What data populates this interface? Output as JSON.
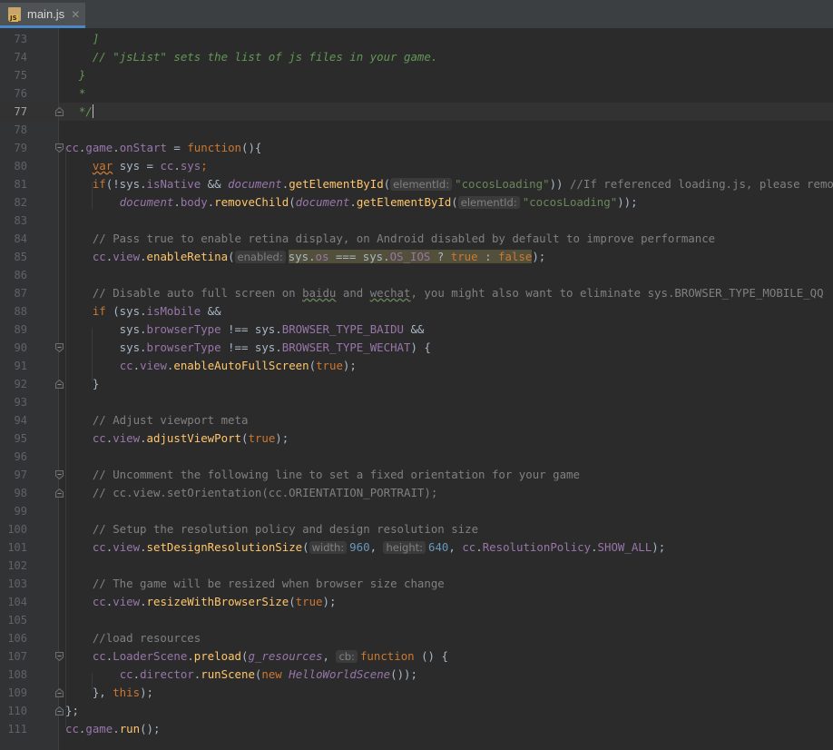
{
  "tab": {
    "file_name": "main.js",
    "icon": "js-file-icon",
    "close_icon": "close-icon",
    "badge": "JS"
  },
  "gutter": {
    "current_line": 77
  },
  "colors": {
    "background": "#2b2b2b",
    "gutter": "#313335",
    "keyword": "#cc7832",
    "string": "#6a8759",
    "number": "#6897bb",
    "comment": "#808080",
    "doc_comment": "#629755",
    "function": "#ffc66d",
    "property": "#9876aa"
  },
  "lines": [
    {
      "n": 73,
      "indent": 4,
      "tokens": [
        [
          "    ]",
          "dc"
        ]
      ]
    },
    {
      "n": 74,
      "indent": 4,
      "tokens": [
        [
          "    // \"jsList\" sets the list of js files in your game.",
          "dc"
        ]
      ]
    },
    {
      "n": 75,
      "tokens": [
        [
          "  }",
          "dc"
        ]
      ]
    },
    {
      "n": 76,
      "tokens": [
        [
          "  *",
          "dc"
        ]
      ]
    },
    {
      "n": 77,
      "fold": "end",
      "tokens": [
        [
          "  */",
          "dc"
        ],
        [
          "",
          "cursor"
        ]
      ]
    },
    {
      "n": 78,
      "tokens": []
    },
    {
      "n": 79,
      "fold": "start",
      "tokens": [
        [
          "cc",
          "pr"
        ],
        [
          ".",
          ""
        ],
        [
          "game",
          "pr"
        ],
        [
          ".",
          ""
        ],
        [
          "onStart",
          "pr"
        ],
        [
          " = ",
          ""
        ],
        [
          "function",
          "kw"
        ],
        [
          "(){",
          ""
        ]
      ]
    },
    {
      "n": 80,
      "tokens": [
        [
          "    ",
          ""
        ],
        [
          "var",
          "kw wavyk"
        ],
        [
          " sys = ",
          ""
        ],
        [
          "cc",
          "pr"
        ],
        [
          ".",
          ""
        ],
        [
          "sys",
          "pr"
        ],
        [
          ";",
          "kw"
        ]
      ]
    },
    {
      "n": 81,
      "tokens": [
        [
          "    ",
          ""
        ],
        [
          "if",
          "kw"
        ],
        [
          "(!sys.",
          ""
        ],
        [
          "isNative",
          "pr"
        ],
        [
          " && ",
          ""
        ],
        [
          "document",
          "ft"
        ],
        [
          ".",
          ""
        ],
        [
          "getElementById",
          "fn"
        ],
        [
          "(",
          ""
        ],
        [
          "elementId:",
          "hint"
        ],
        [
          "\"cocosLoading\"",
          "st"
        ],
        [
          ")) ",
          ""
        ],
        [
          "//If referenced loading.js, please remove it",
          "cm"
        ]
      ]
    },
    {
      "n": 82,
      "tokens": [
        [
          "        ",
          ""
        ],
        [
          "document",
          "ft"
        ],
        [
          ".",
          ""
        ],
        [
          "body",
          "pr"
        ],
        [
          ".",
          ""
        ],
        [
          "removeChild",
          "fn"
        ],
        [
          "(",
          ""
        ],
        [
          "document",
          "ft"
        ],
        [
          ".",
          ""
        ],
        [
          "getElementById",
          "fn"
        ],
        [
          "(",
          ""
        ],
        [
          "elementId:",
          "hint"
        ],
        [
          "\"cocosLoading\"",
          "st"
        ],
        [
          "));",
          ""
        ]
      ]
    },
    {
      "n": 83,
      "tokens": []
    },
    {
      "n": 84,
      "tokens": [
        [
          "    // Pass true to enable retina display, on Android disabled by default to improve performance",
          "cm"
        ]
      ]
    },
    {
      "n": 85,
      "tokens": [
        [
          "    ",
          ""
        ],
        [
          "cc",
          "pr"
        ],
        [
          ".",
          ""
        ],
        [
          "view",
          "pr"
        ],
        [
          ".",
          ""
        ],
        [
          "enableRetina",
          "fn"
        ],
        [
          "(",
          ""
        ],
        [
          "enabled:",
          "hint"
        ],
        [
          "sys.",
          "hl"
        ],
        [
          "os",
          "hl pr"
        ],
        [
          " === sys.",
          "hl"
        ],
        [
          "OS_IOS",
          "hl pr"
        ],
        [
          " ? ",
          "hl"
        ],
        [
          "true",
          "hl kw"
        ],
        [
          " : ",
          "hl"
        ],
        [
          "false",
          "hl kw"
        ],
        [
          ");",
          ""
        ]
      ]
    },
    {
      "n": 86,
      "tokens": []
    },
    {
      "n": 87,
      "tokens": [
        [
          "    // Disable auto full screen on ",
          "cm"
        ],
        [
          "baidu",
          "cm wavy"
        ],
        [
          " and ",
          "cm"
        ],
        [
          "wechat",
          "cm wavy"
        ],
        [
          ", you might also want to eliminate sys.BROWSER_TYPE_MOBILE_QQ",
          "cm"
        ]
      ]
    },
    {
      "n": 88,
      "tokens": [
        [
          "    ",
          ""
        ],
        [
          "if",
          "kw"
        ],
        [
          " (sys.",
          ""
        ],
        [
          "isMobile",
          "pr"
        ],
        [
          " &&",
          ""
        ]
      ]
    },
    {
      "n": 89,
      "tokens": [
        [
          "        sys.",
          ""
        ],
        [
          "browserType",
          "pr"
        ],
        [
          " !== sys.",
          ""
        ],
        [
          "BROWSER_TYPE_BAIDU",
          "pr"
        ],
        [
          " &&",
          ""
        ]
      ]
    },
    {
      "n": 90,
      "fold": "start",
      "tokens": [
        [
          "        sys.",
          ""
        ],
        [
          "browserType",
          "pr"
        ],
        [
          " !== sys.",
          ""
        ],
        [
          "BROWSER_TYPE_WECHAT",
          "pr"
        ],
        [
          ") {",
          ""
        ]
      ]
    },
    {
      "n": 91,
      "tokens": [
        [
          "        ",
          ""
        ],
        [
          "cc",
          "pr"
        ],
        [
          ".",
          ""
        ],
        [
          "view",
          "pr"
        ],
        [
          ".",
          ""
        ],
        [
          "enableAutoFullScreen",
          "fn"
        ],
        [
          "(",
          ""
        ],
        [
          "true",
          "kw"
        ],
        [
          ");",
          ""
        ]
      ]
    },
    {
      "n": 92,
      "fold": "end",
      "tokens": [
        [
          "    }",
          ""
        ]
      ]
    },
    {
      "n": 93,
      "tokens": []
    },
    {
      "n": 94,
      "tokens": [
        [
          "    // Adjust viewport meta",
          "cm"
        ]
      ]
    },
    {
      "n": 95,
      "tokens": [
        [
          "    ",
          ""
        ],
        [
          "cc",
          "pr"
        ],
        [
          ".",
          ""
        ],
        [
          "view",
          "pr"
        ],
        [
          ".",
          ""
        ],
        [
          "adjustViewPort",
          "fn"
        ],
        [
          "(",
          ""
        ],
        [
          "true",
          "kw"
        ],
        [
          ");",
          ""
        ]
      ]
    },
    {
      "n": 96,
      "tokens": []
    },
    {
      "n": 97,
      "fold": "start",
      "tokens": [
        [
          "    // Uncomment the following line to set a fixed orientation for your game",
          "cm"
        ]
      ]
    },
    {
      "n": 98,
      "fold": "end",
      "tokens": [
        [
          "    // cc.view.setOrientation(cc.ORIENTATION_PORTRAIT);",
          "cm"
        ]
      ]
    },
    {
      "n": 99,
      "tokens": []
    },
    {
      "n": 100,
      "tokens": [
        [
          "    // Setup the resolution policy and design resolution size",
          "cm"
        ]
      ]
    },
    {
      "n": 101,
      "tokens": [
        [
          "    ",
          ""
        ],
        [
          "cc",
          "pr"
        ],
        [
          ".",
          ""
        ],
        [
          "view",
          "pr"
        ],
        [
          ".",
          ""
        ],
        [
          "setDesignResolutionSize",
          "fn"
        ],
        [
          "(",
          ""
        ],
        [
          "width:",
          "hint"
        ],
        [
          "960",
          "nu"
        ],
        [
          ", ",
          ""
        ],
        [
          "height:",
          "hint"
        ],
        [
          "640",
          "nu"
        ],
        [
          ", ",
          ""
        ],
        [
          "cc",
          "pr"
        ],
        [
          ".",
          ""
        ],
        [
          "ResolutionPolicy",
          "pr"
        ],
        [
          ".",
          ""
        ],
        [
          "SHOW_ALL",
          "pr"
        ],
        [
          ");",
          ""
        ]
      ]
    },
    {
      "n": 102,
      "tokens": []
    },
    {
      "n": 103,
      "tokens": [
        [
          "    // The game will be resized when browser size change",
          "cm"
        ]
      ]
    },
    {
      "n": 104,
      "tokens": [
        [
          "    ",
          ""
        ],
        [
          "cc",
          "pr"
        ],
        [
          ".",
          ""
        ],
        [
          "view",
          "pr"
        ],
        [
          ".",
          ""
        ],
        [
          "resizeWithBrowserSize",
          "fn"
        ],
        [
          "(",
          ""
        ],
        [
          "true",
          "kw"
        ],
        [
          ");",
          ""
        ]
      ]
    },
    {
      "n": 105,
      "tokens": []
    },
    {
      "n": 106,
      "tokens": [
        [
          "    //load resources",
          "cm"
        ]
      ]
    },
    {
      "n": 107,
      "fold": "start",
      "tokens": [
        [
          "    ",
          ""
        ],
        [
          "cc",
          "pr"
        ],
        [
          ".",
          ""
        ],
        [
          "LoaderScene",
          "pr"
        ],
        [
          ".",
          ""
        ],
        [
          "preload",
          "fn"
        ],
        [
          "(",
          ""
        ],
        [
          "g_resources",
          "ft"
        ],
        [
          ", ",
          ""
        ],
        [
          "cb:",
          "hint"
        ],
        [
          "function",
          "kw"
        ],
        [
          " () {",
          ""
        ]
      ]
    },
    {
      "n": 108,
      "tokens": [
        [
          "        ",
          ""
        ],
        [
          "cc",
          "pr"
        ],
        [
          ".",
          ""
        ],
        [
          "director",
          "pr"
        ],
        [
          ".",
          ""
        ],
        [
          "runScene",
          "fn"
        ],
        [
          "(",
          ""
        ],
        [
          "new ",
          "kw"
        ],
        [
          "HelloWorldScene",
          "ft"
        ],
        [
          "());",
          ""
        ]
      ]
    },
    {
      "n": 109,
      "fold": "end",
      "tokens": [
        [
          "    }, ",
          ""
        ],
        [
          "this",
          "kw"
        ],
        [
          ");",
          ""
        ]
      ]
    },
    {
      "n": 110,
      "fold": "end",
      "tokens": [
        [
          "};",
          ""
        ]
      ]
    },
    {
      "n": 111,
      "tokens": [
        [
          "cc",
          "pr"
        ],
        [
          ".",
          ""
        ],
        [
          "game",
          "pr"
        ],
        [
          ".",
          ""
        ],
        [
          "run",
          "fn"
        ],
        [
          "();",
          ""
        ]
      ]
    }
  ]
}
